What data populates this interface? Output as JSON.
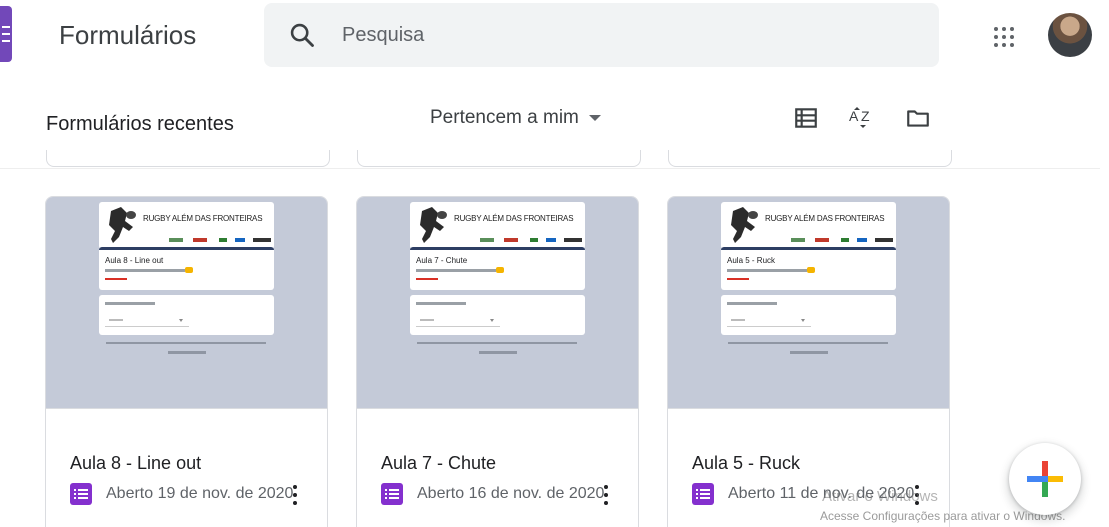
{
  "header": {
    "app_title": "Formulários",
    "search_placeholder": "Pesquisa"
  },
  "subheader": {
    "recent_title": "Formulários recentes",
    "owner_filter": "Pertencem a mim"
  },
  "cards": [
    {
      "title": "Aula 8 - Line out",
      "meta": "Aberto 19 de nov. de 2020",
      "thumb_banner": "RUGBY ALÉM DAS FRONTEIRAS",
      "thumb_title": "Aula 8 - Line out"
    },
    {
      "title": "Aula 7 - Chute",
      "meta": "Aberto 16 de nov. de 2020",
      "thumb_banner": "RUGBY ALÉM DAS FRONTEIRAS",
      "thumb_title": "Aula 7 - Chute"
    },
    {
      "title": "Aula 5 - Ruck",
      "meta": "Aberto 11 de nov. de 2020",
      "thumb_banner": "RUGBY ALÉM DAS FRONTEIRAS",
      "thumb_title": "Aula 5 - Ruck"
    }
  ],
  "watermark": {
    "line1": "Ativar o Windows",
    "line2": "Acesse Configurações para ativar o Windows."
  },
  "colors": {
    "forms_purple": "#7248b9",
    "badge_purple": "#8430ce",
    "thumb_bg": "#c4cad8"
  },
  "icons": [
    "forms-logo-icon",
    "search-icon",
    "apps-grid-icon",
    "list-view-icon",
    "sort-az-icon",
    "folder-icon",
    "form-badge-icon",
    "more-vert-icon",
    "plus-icon"
  ]
}
